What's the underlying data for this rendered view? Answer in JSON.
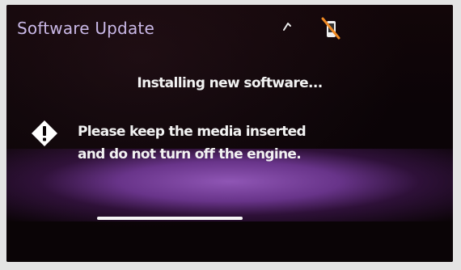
{
  "header": {
    "title": "Software Update",
    "icons": [
      "signal-icon",
      "phone-disconnected-icon"
    ]
  },
  "main": {
    "status_text": "Installing new software...",
    "warning_icon": "warning-diamond-icon",
    "message_line1": "Please keep the media inserted",
    "message_line2": "and do not turn off the engine."
  },
  "progress": {
    "value": 1.0
  },
  "colors": {
    "title": "#c9b8e6",
    "glow": "#9a5ac0",
    "text": "#f2f2f2"
  }
}
